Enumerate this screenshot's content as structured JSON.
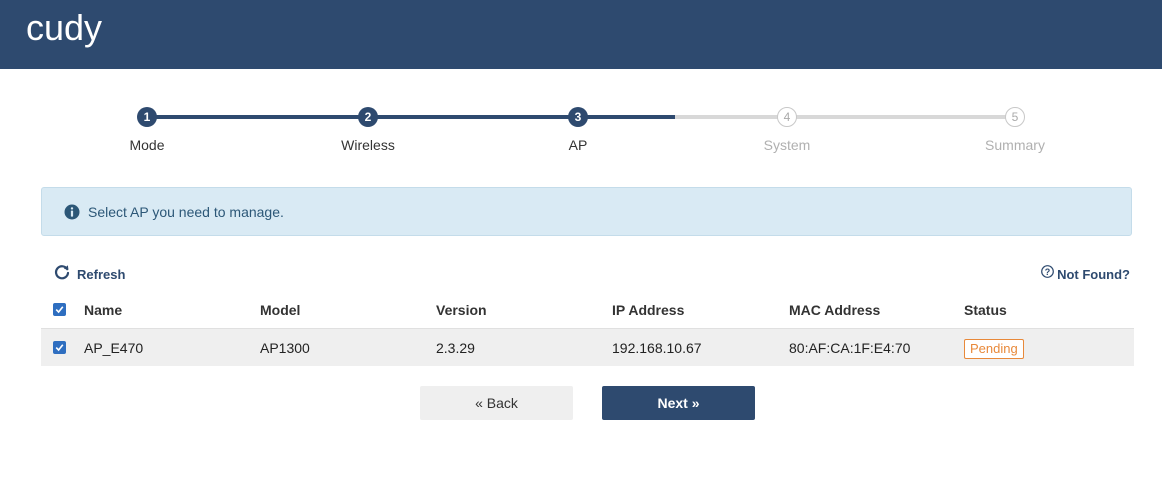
{
  "header": {
    "logo_text": "cudy",
    "bg_color": "#2e4a6f"
  },
  "wizard": {
    "current_step": 3,
    "steps": [
      {
        "number": "1",
        "label": "Mode",
        "state": "done"
      },
      {
        "number": "2",
        "label": "Wireless",
        "state": "done"
      },
      {
        "number": "3",
        "label": "AP",
        "state": "done"
      },
      {
        "number": "4",
        "label": "System",
        "state": "todo"
      },
      {
        "number": "5",
        "label": "Summary",
        "state": "todo"
      }
    ]
  },
  "info": {
    "icon": "info-circle-icon",
    "text": "Select AP you need to manage."
  },
  "toolbar": {
    "refresh_label": "Refresh",
    "refresh_icon": "refresh-icon",
    "notfound_label": "Not Found?",
    "notfound_icon": "question-circle-icon"
  },
  "table": {
    "select_all_checked": true,
    "columns": [
      "Name",
      "Model",
      "Version",
      "IP Address",
      "MAC Address",
      "Status"
    ],
    "rows": [
      {
        "checked": true,
        "name": "AP_E470",
        "model": "AP1300",
        "version": "2.3.29",
        "ip": "192.168.10.67",
        "mac": "80:AF:CA:1F:E4:70",
        "status": "Pending",
        "status_color": "#e8893a"
      }
    ]
  },
  "buttons": {
    "back_label": "« Back",
    "next_label": "Next »"
  },
  "colors": {
    "primary": "#2e4a6f",
    "info_bg": "#d9eaf4",
    "checkbox": "#2e6ec0",
    "pending": "#e8893a"
  }
}
